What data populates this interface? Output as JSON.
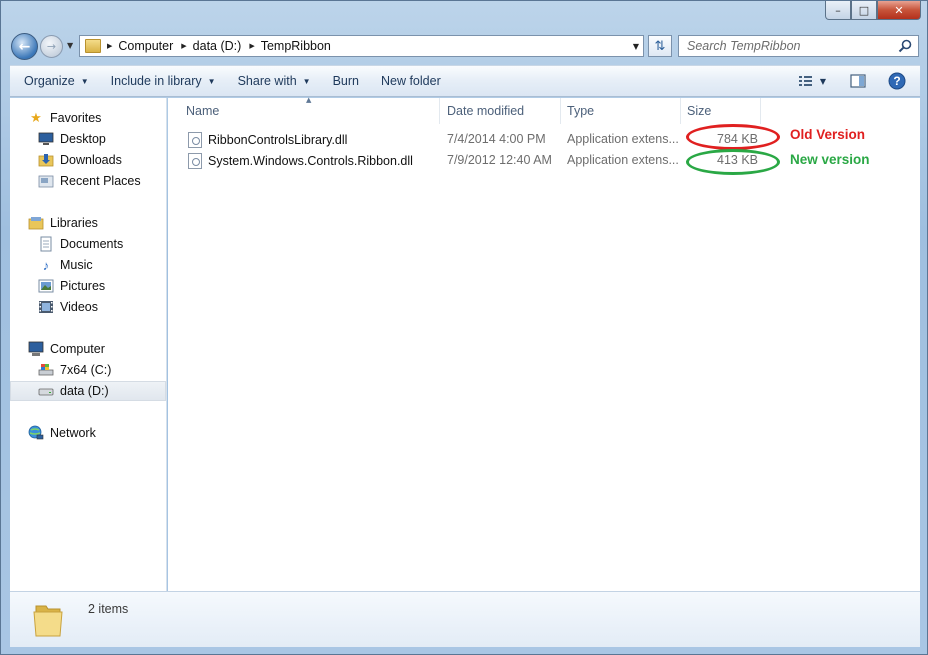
{
  "window": {
    "caption_buttons": [
      "minimize",
      "maximize",
      "close"
    ]
  },
  "address": {
    "crumbs": [
      "Computer",
      "data (D:)",
      "TempRibbon"
    ]
  },
  "search": {
    "placeholder": "Search TempRibbon"
  },
  "toolbar": {
    "organize": "Organize",
    "include_in_library": "Include in library",
    "share_with": "Share with",
    "burn": "Burn",
    "new_folder": "New folder",
    "icons": [
      "views-icon",
      "preview-pane-icon",
      "help-icon"
    ]
  },
  "nav": {
    "favorites": {
      "label": "Favorites",
      "items": [
        "Desktop",
        "Downloads",
        "Recent Places"
      ]
    },
    "libraries": {
      "label": "Libraries",
      "items": [
        "Documents",
        "Music",
        "Pictures",
        "Videos"
      ]
    },
    "computer": {
      "label": "Computer",
      "items": [
        "7x64 (C:)",
        "data (D:)"
      ],
      "selected": "data (D:)"
    },
    "network": {
      "label": "Network"
    }
  },
  "columns": [
    "Name",
    "Date modified",
    "Type",
    "Size"
  ],
  "files": [
    {
      "name": "RibbonControlsLibrary.dll",
      "date": "7/4/2014 4:00 PM",
      "type": "Application extens...",
      "size": "784 KB"
    },
    {
      "name": "System.Windows.Controls.Ribbon.dll",
      "date": "7/9/2012 12:40 AM",
      "type": "Application extens...",
      "size": "413 KB"
    }
  ],
  "annotations": [
    {
      "text": "Old Version",
      "color": "#e02020"
    },
    {
      "text": "New version",
      "color": "#2aa845"
    }
  ],
  "status": {
    "count": "2 items"
  },
  "colors": {
    "accent": "#1e395b",
    "old": "#e02020",
    "new": "#2aa845"
  }
}
